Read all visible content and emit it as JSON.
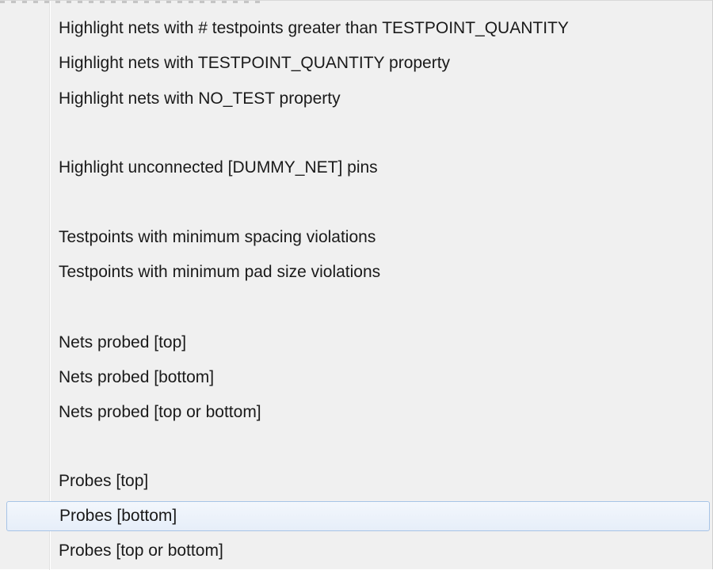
{
  "menu": {
    "items": [
      {
        "label": "Highlight nets with # testpoints greater than TESTPOINT_QUANTITY",
        "hovered": false
      },
      {
        "label": "Highlight nets with TESTPOINT_QUANTITY property",
        "hovered": false
      },
      {
        "label": "Highlight nets with NO_TEST property",
        "hovered": false
      },
      {
        "label": "Highlight unconnected [DUMMY_NET] pins",
        "hovered": false
      },
      {
        "label": "Testpoints with minimum spacing violations",
        "hovered": false
      },
      {
        "label": "Testpoints with minimum pad size violations",
        "hovered": false
      },
      {
        "label": "Nets probed [top]",
        "hovered": false
      },
      {
        "label": "Nets probed [bottom]",
        "hovered": false
      },
      {
        "label": "Nets probed [top or bottom]",
        "hovered": false
      },
      {
        "label": "Probes [top]",
        "hovered": false
      },
      {
        "label": "Probes [bottom]",
        "hovered": true
      },
      {
        "label": "Probes [top or bottom]",
        "hovered": false
      }
    ]
  }
}
